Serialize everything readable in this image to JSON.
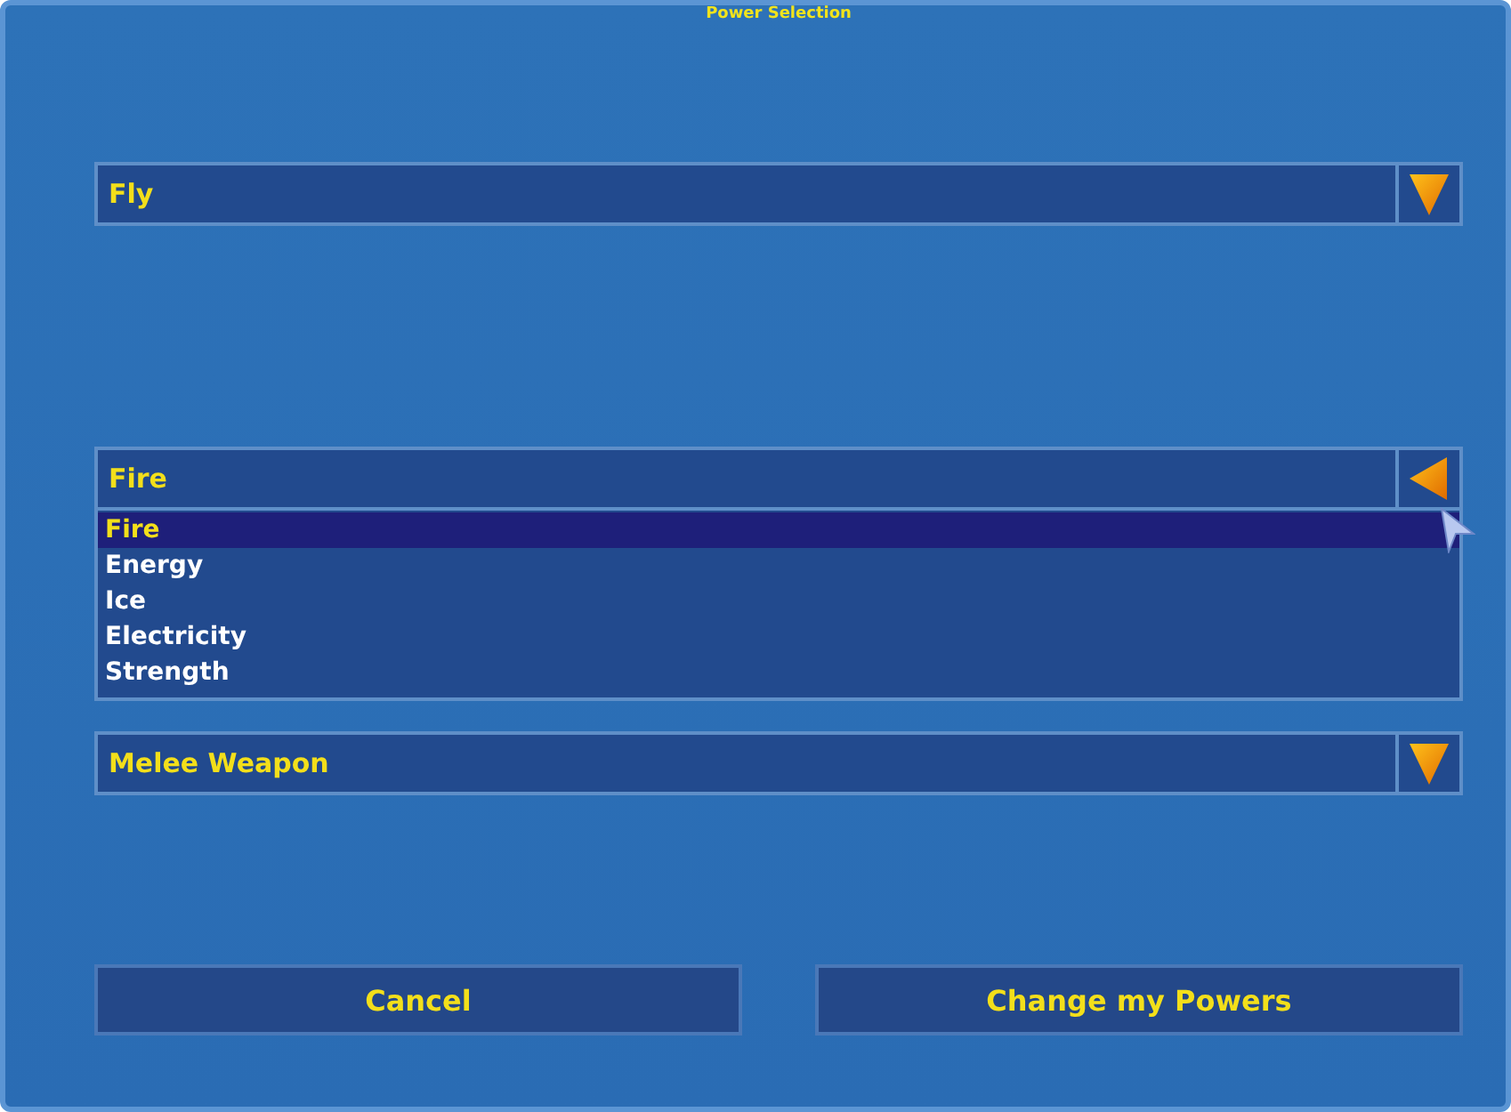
{
  "window": {
    "title": "Power Selection"
  },
  "dropdowns": [
    {
      "value": "Fly",
      "expanded": false
    },
    {
      "value": "Fire",
      "expanded": true,
      "options": [
        {
          "label": "Fire",
          "selected": true
        },
        {
          "label": "Energy",
          "selected": false
        },
        {
          "label": "Ice",
          "selected": false
        },
        {
          "label": "Electricity",
          "selected": false
        },
        {
          "label": "Strength",
          "selected": false
        }
      ]
    },
    {
      "value": "Melee Weapon",
      "expanded": false
    }
  ],
  "buttons": [
    "Cancel",
    "Change my Powers"
  ]
}
